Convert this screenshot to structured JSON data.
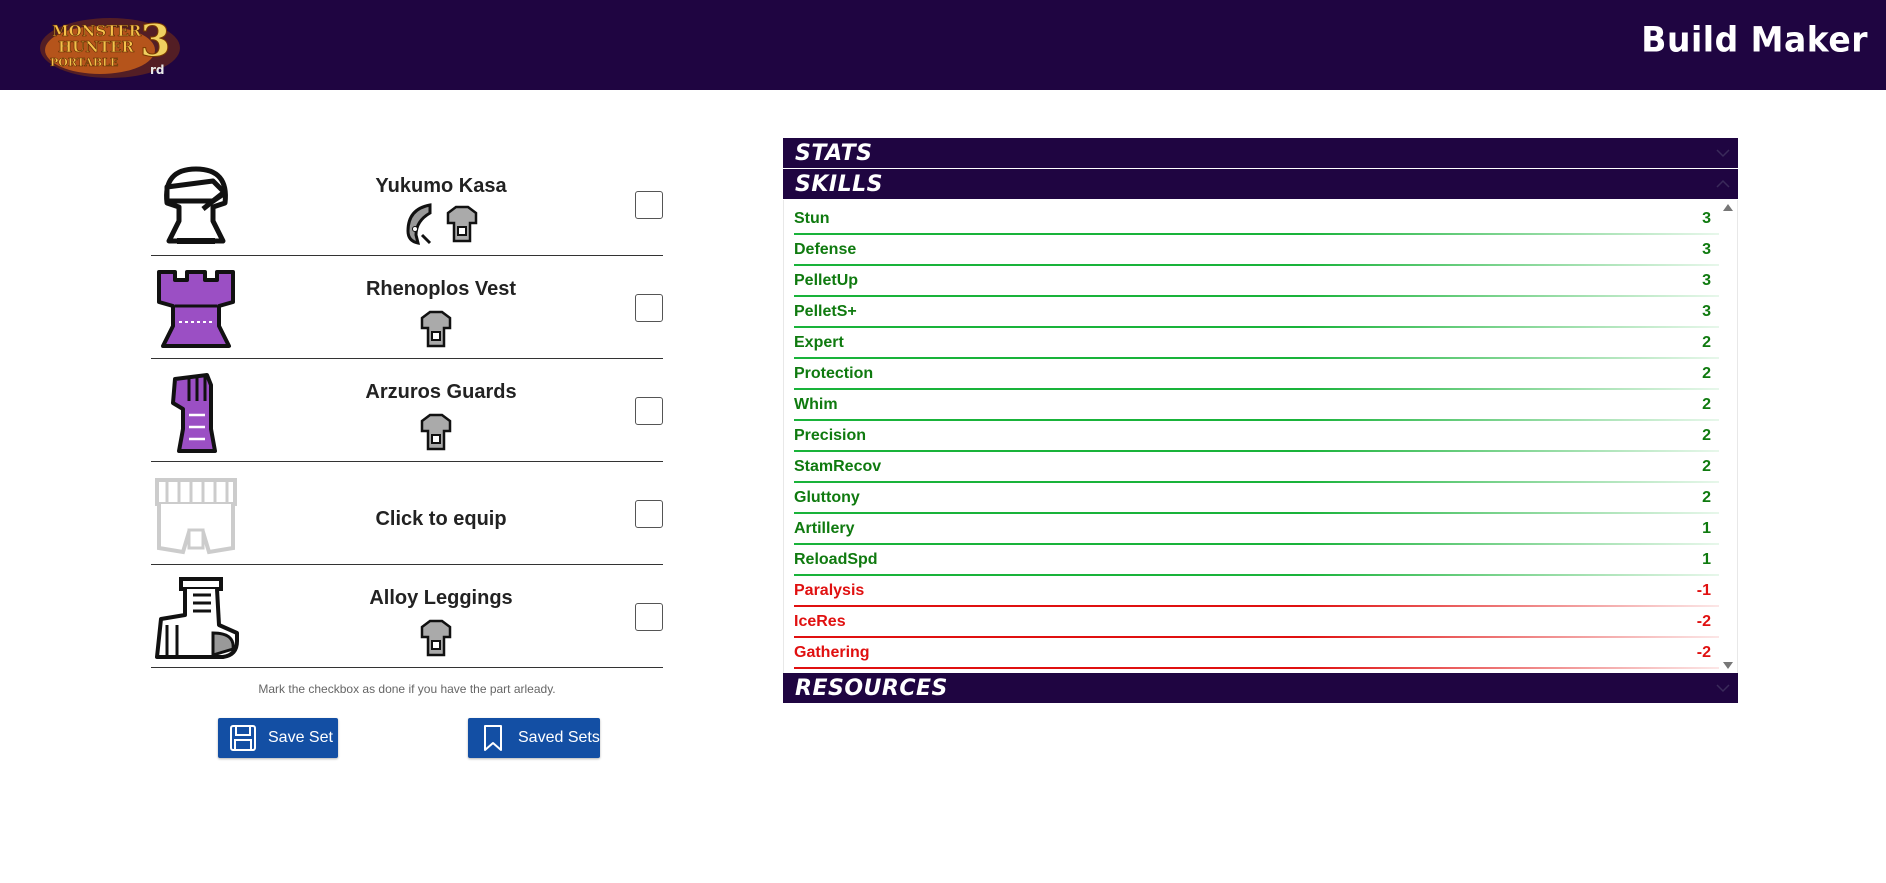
{
  "header": {
    "logo_text": "Monster Hunter Portable 3rd",
    "brand": "Build Maker",
    "background": "#1f0541"
  },
  "armor": [
    {
      "name": "Yukumo Kasa",
      "icon": "helmet-icon",
      "done": false
    },
    {
      "name": "Rhenoplos Vest",
      "icon": "chest-icon",
      "done": false
    },
    {
      "name": "Arzuros Guards",
      "icon": "arms-icon",
      "done": false
    },
    {
      "name": "Click to equip",
      "icon": "waist-icon",
      "done": false
    },
    {
      "name": "Alloy Leggings",
      "icon": "legs-icon",
      "done": false
    }
  ],
  "hint": "Mark the checkbox as done if you have the part arleady.",
  "buttons": {
    "save": "Save Set",
    "saved": "Saved Sets"
  },
  "panel": {
    "stats_title": "STATS",
    "skills_title": "SKILLS",
    "resources_title": "RESOURCES",
    "skills": [
      {
        "name": "Stun",
        "value": "3"
      },
      {
        "name": "Defense",
        "value": "3"
      },
      {
        "name": "PelletUp",
        "value": "3"
      },
      {
        "name": "PelletS+",
        "value": "3"
      },
      {
        "name": "Expert",
        "value": "2"
      },
      {
        "name": "Protection",
        "value": "2"
      },
      {
        "name": "Whim",
        "value": "2"
      },
      {
        "name": "Precision",
        "value": "2"
      },
      {
        "name": "StamRecov",
        "value": "2"
      },
      {
        "name": "Gluttony",
        "value": "2"
      },
      {
        "name": "Artillery",
        "value": "1"
      },
      {
        "name": "ReloadSpd",
        "value": "1"
      },
      {
        "name": "Paralysis",
        "value": "-1"
      },
      {
        "name": "IceRes",
        "value": "-2"
      },
      {
        "name": "Gathering",
        "value": "-2"
      }
    ],
    "positive_color": "#0f7a0f",
    "negative_color": "#e01010"
  }
}
